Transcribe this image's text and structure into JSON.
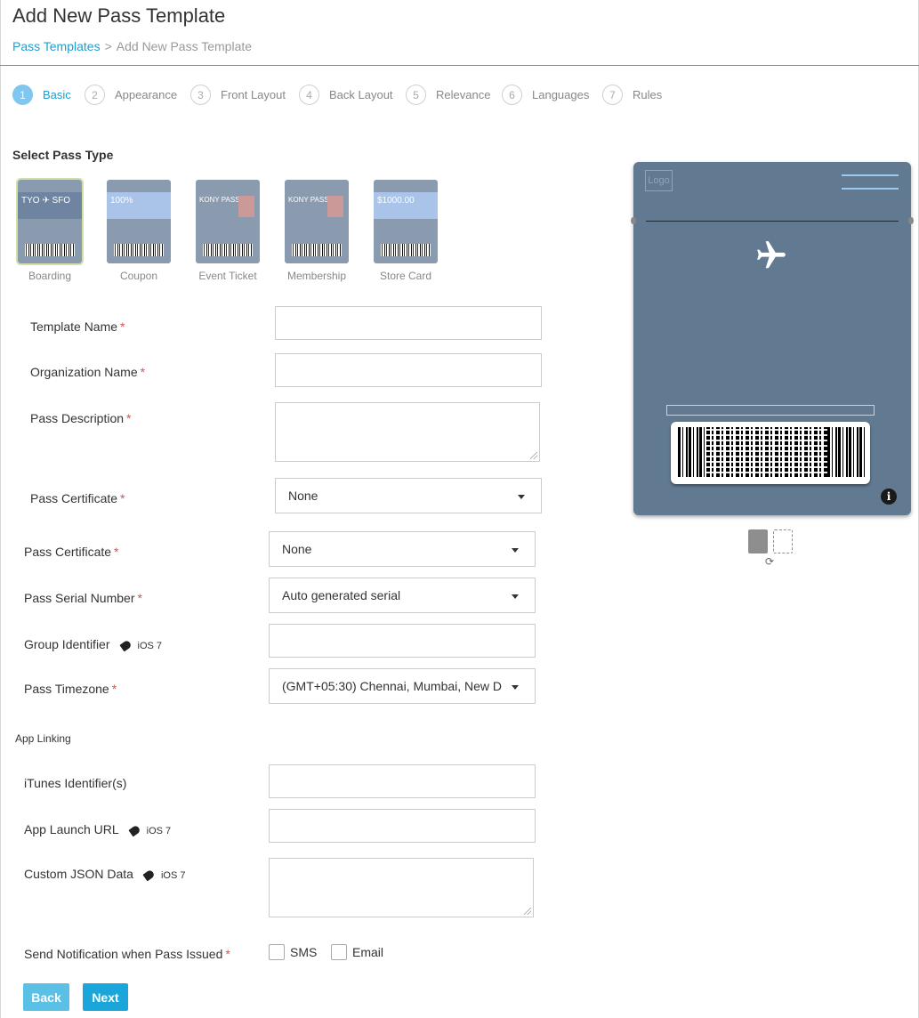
{
  "page": {
    "title": "Add New Pass Template",
    "breadcrumb": {
      "parent": "Pass Templates",
      "separator": ">",
      "current": "Add New Pass Template"
    }
  },
  "steps": [
    {
      "num": "1",
      "label": "Basic",
      "active": true
    },
    {
      "num": "2",
      "label": "Appearance"
    },
    {
      "num": "3",
      "label": "Front Layout"
    },
    {
      "num": "4",
      "label": "Back Layout"
    },
    {
      "num": "5",
      "label": "Relevance"
    },
    {
      "num": "6",
      "label": "Languages"
    },
    {
      "num": "7",
      "label": "Rules"
    }
  ],
  "pass_type": {
    "label": "Select Pass Type",
    "selected": "Boarding",
    "types": [
      {
        "name": "Boarding",
        "from": "TYO",
        "to": "SFO"
      },
      {
        "name": "Coupon",
        "headline": "100%"
      },
      {
        "name": "Event Ticket",
        "headline": "KONY PASS"
      },
      {
        "name": "Membership",
        "headline": "KONY PASS"
      },
      {
        "name": "Store Card",
        "headline": "$1000.00"
      }
    ]
  },
  "form": {
    "template_name": {
      "label": "Template Name",
      "value": ""
    },
    "organization_name": {
      "label": "Organization Name",
      "value": ""
    },
    "pass_description": {
      "label": "Pass Description",
      "value": ""
    },
    "pass_certificate_1": {
      "label": "Pass Certificate",
      "value": "None"
    },
    "pass_certificate_2": {
      "label": "Pass Certificate",
      "value": "None"
    },
    "pass_serial_number": {
      "label": "Pass Serial Number",
      "value": "Auto generated serial"
    },
    "group_identifier": {
      "label": "Group Identifier",
      "tag": "iOS 7",
      "value": ""
    },
    "pass_timezone": {
      "label": "Pass Timezone",
      "value": "(GMT+05:30) Chennai, Mumbai, New D"
    },
    "required_mark": "*"
  },
  "app_linking": {
    "label": "App Linking",
    "itunes_identifiers": {
      "label": "iTunes Identifier(s)",
      "value": ""
    },
    "app_launch_url": {
      "label": "App Launch URL",
      "tag": "iOS 7",
      "value": ""
    },
    "custom_json": {
      "label": "Custom JSON Data",
      "tag": "iOS 7",
      "value": ""
    }
  },
  "notification": {
    "label": "Send Notification when Pass Issued",
    "options": [
      {
        "label": "SMS",
        "checked": false
      },
      {
        "label": "Email",
        "checked": false
      }
    ]
  },
  "buttons": {
    "back": "Back",
    "next": "Next"
  },
  "preview": {
    "logo": "Logo",
    "info_glyph": "i",
    "rotate_glyph": "⟳"
  },
  "colors": {
    "accent": "#1aa6db",
    "preview_bg": "#617a92",
    "required": "#d9534f"
  }
}
